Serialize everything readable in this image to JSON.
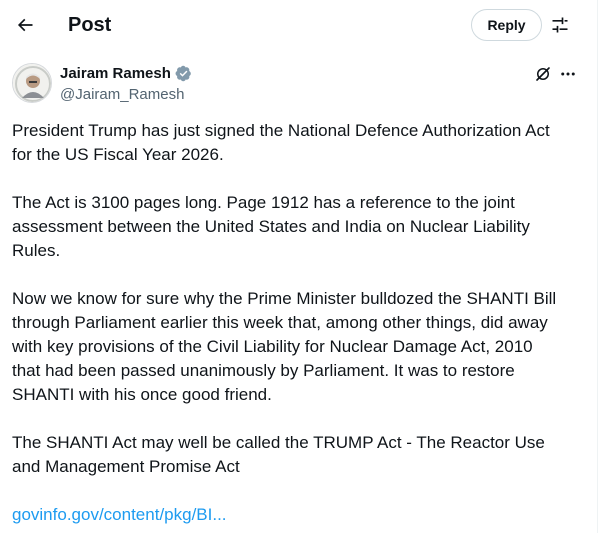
{
  "header": {
    "title": "Post",
    "reply_label": "Reply"
  },
  "author": {
    "name": "Jairam Ramesh",
    "handle": "@Jairam_Ramesh",
    "verified_color": "#829aab"
  },
  "post": {
    "paragraphs": [
      [
        "President Trump has just signed the National Defence Authorization Act",
        "for the US Fiscal Year 2026."
      ],
      [
        "The Act is 3100 pages long. Page 1912 has a reference to the joint",
        "assessment between the United States and India on Nuclear Liability",
        "Rules."
      ],
      [
        "Now we know for sure why the Prime Minister bulldozed the SHANTI Bill",
        "through Parliament earlier this week that, among other things, did away",
        "with key provisions of the Civil Liability for Nuclear Damage Act, 2010",
        "that had been passed unanimously by Parliament. It was to restore",
        "SHANTI with his once good friend."
      ],
      [
        "The SHANTI Act may well be called the TRUMP Act - The Reactor Use",
        "and Management Promise Act"
      ]
    ],
    "link_text": "govinfo.gov/content/pkg/BI..."
  },
  "icons": {
    "back": "arrow-left-icon",
    "filter": "sliders-icon",
    "verified": "verified-badge-icon",
    "grok": "grok-icon",
    "more": "more-dots-icon"
  },
  "colors": {
    "text": "#0f1419",
    "secondary_text": "#536471",
    "link": "#1d9bf0",
    "border": "#cfd9de"
  }
}
